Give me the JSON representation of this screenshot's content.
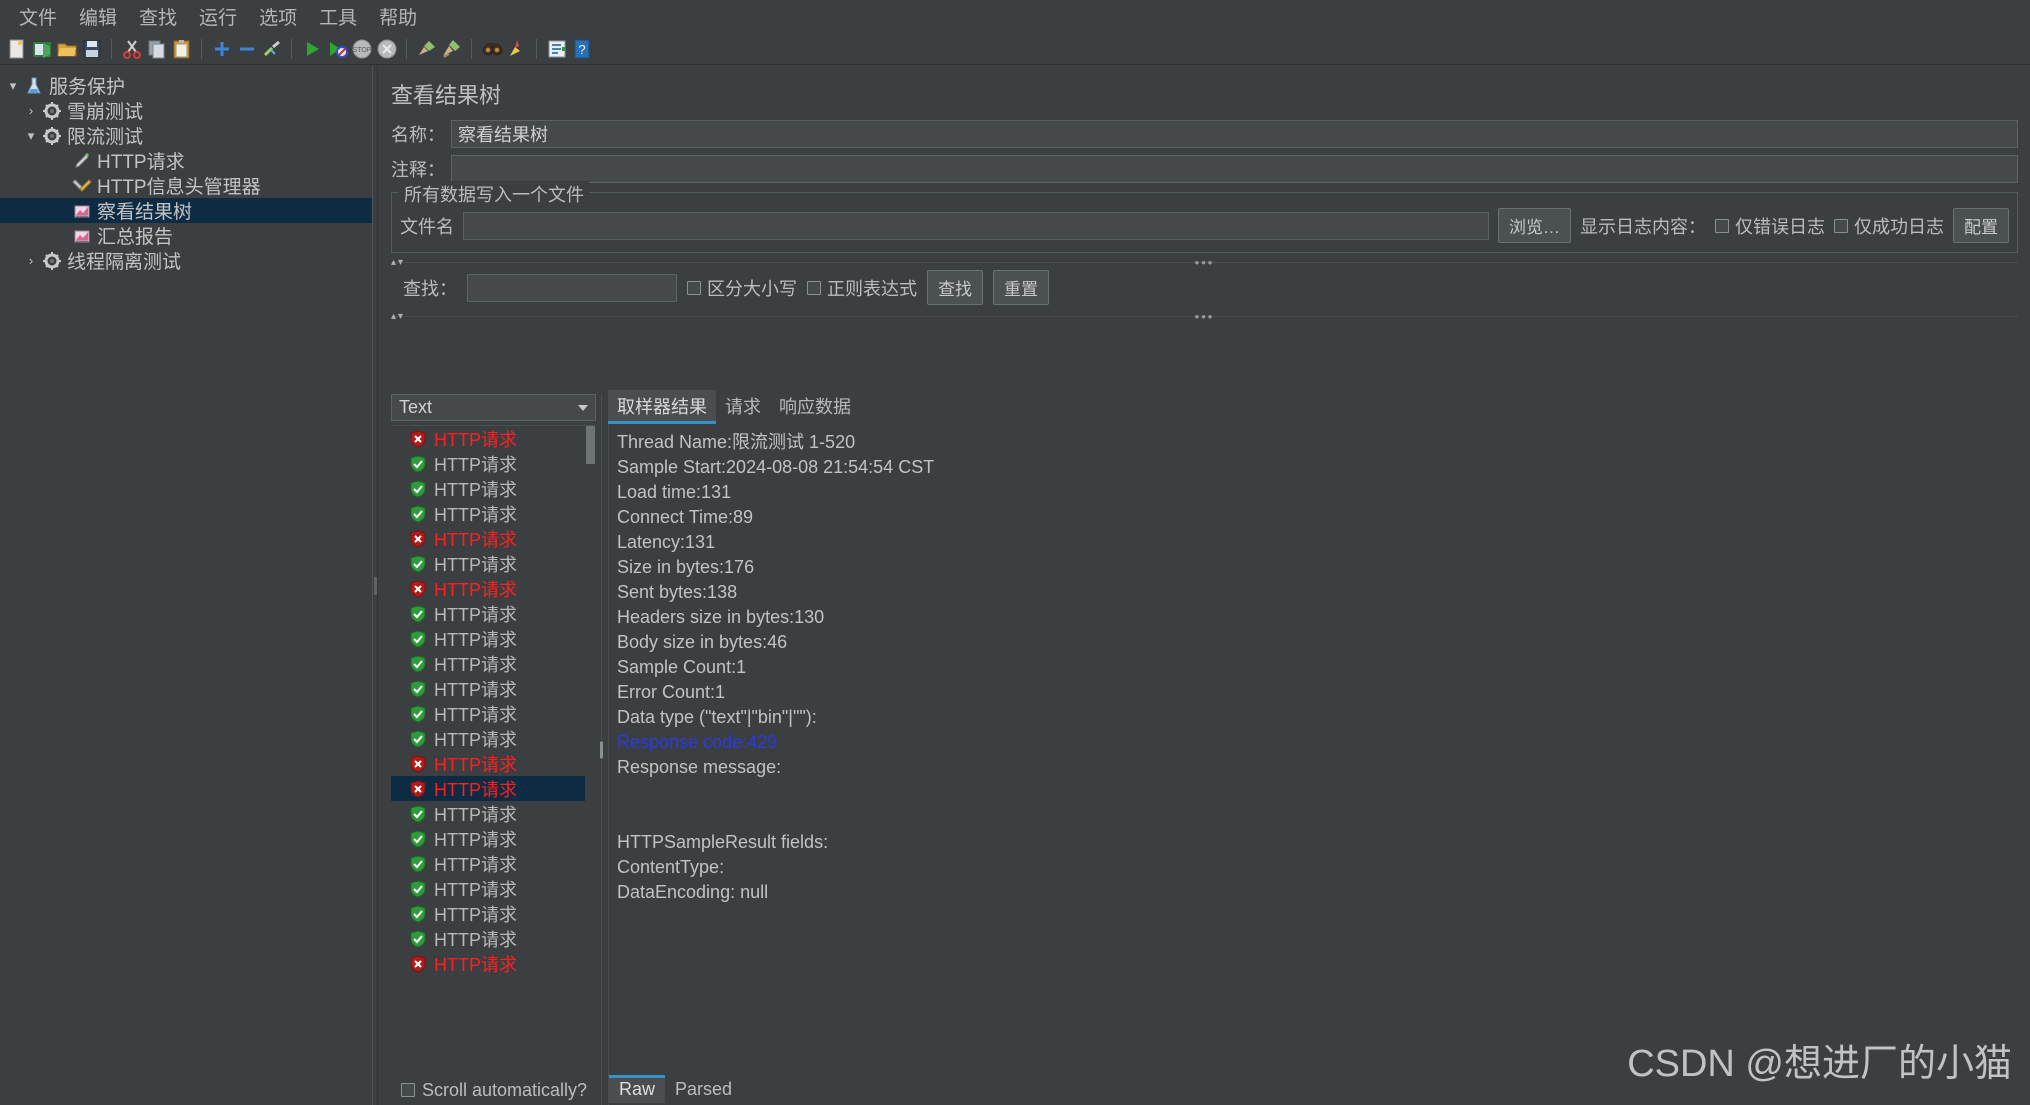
{
  "menubar": {
    "items": [
      "文件",
      "编辑",
      "查找",
      "运行",
      "选项",
      "工具",
      "帮助"
    ]
  },
  "toolbar": {
    "buttons": [
      {
        "name": "new-icon",
        "title": "新建"
      },
      {
        "name": "templates-icon",
        "title": "模板"
      },
      {
        "name": "open-icon",
        "title": "打开"
      },
      {
        "name": "save-icon",
        "title": "保存"
      },
      {
        "name": "cut-icon",
        "title": "剪切"
      },
      {
        "name": "copy-icon",
        "title": "复制"
      },
      {
        "name": "paste-icon",
        "title": "粘贴"
      },
      {
        "name": "expand-all-icon",
        "title": "展开全部"
      },
      {
        "name": "collapse-all-icon",
        "title": "折叠全部"
      },
      {
        "name": "toggle-icon",
        "title": "启用/禁用"
      },
      {
        "name": "start-icon",
        "title": "启动"
      },
      {
        "name": "start-no-timers-icon",
        "title": "无间隔启动"
      },
      {
        "name": "stop-icon",
        "title": "停止"
      },
      {
        "name": "shutdown-icon",
        "title": "关闭"
      },
      {
        "name": "clear-icon",
        "title": "清除"
      },
      {
        "name": "clear-all-icon",
        "title": "清除全部"
      },
      {
        "name": "search-icon",
        "title": "查找"
      },
      {
        "name": "search-reset-icon",
        "title": "重置查找"
      },
      {
        "name": "function-helper-icon",
        "title": "函数助手"
      },
      {
        "name": "help-icon",
        "title": "帮助"
      }
    ]
  },
  "tree": {
    "nodes": [
      {
        "label": "服务保护",
        "icon": "test-plan-icon",
        "twisty": "▾",
        "indent": 0,
        "selected": false
      },
      {
        "label": "雪崩测试",
        "icon": "thread-group-icon",
        "twisty": "›",
        "indent": 1,
        "selected": false
      },
      {
        "label": "限流测试",
        "icon": "thread-group-icon",
        "twisty": "▾",
        "indent": 1,
        "selected": false
      },
      {
        "label": "HTTP请求",
        "icon": "http-sampler-icon",
        "twisty": "",
        "indent": 2,
        "selected": false
      },
      {
        "label": "HTTP信息头管理器",
        "icon": "header-manager-icon",
        "twisty": "",
        "indent": 2,
        "selected": false
      },
      {
        "label": "察看结果树",
        "icon": "listener-icon",
        "twisty": "",
        "indent": 2,
        "selected": true
      },
      {
        "label": "汇总报告",
        "icon": "listener-icon",
        "twisty": "",
        "indent": 2,
        "selected": false
      },
      {
        "label": "线程隔离测试",
        "icon": "thread-group-icon",
        "twisty": "›",
        "indent": 1,
        "selected": false
      }
    ]
  },
  "panel": {
    "title": "查看结果树",
    "name_label": "名称：",
    "name_value": "察看结果树",
    "comment_label": "注释：",
    "comment_value": "",
    "file_group_title": "所有数据写入一个文件",
    "filename_label": "文件名",
    "filename_value": "",
    "browse_button": "浏览…",
    "log_display_label": "显示日志内容：",
    "error_only_label": "仅错误日志",
    "success_only_label": "仅成功日志",
    "configure_button": "配置"
  },
  "search": {
    "label": "查找：",
    "value": "",
    "case_sensitive_label": "区分大小写",
    "regex_label": "正则表达式",
    "find_button": "查找",
    "reset_button": "重置"
  },
  "results": {
    "renderer_selected": "Text",
    "scroll_auto_label": "Scroll automatically?",
    "item_label": "HTTP请求",
    "items": [
      {
        "status": "err",
        "selected": false
      },
      {
        "status": "ok",
        "selected": false
      },
      {
        "status": "ok",
        "selected": false
      },
      {
        "status": "ok",
        "selected": false
      },
      {
        "status": "err",
        "selected": false
      },
      {
        "status": "ok",
        "selected": false
      },
      {
        "status": "err",
        "selected": false
      },
      {
        "status": "ok",
        "selected": false
      },
      {
        "status": "ok",
        "selected": false
      },
      {
        "status": "ok",
        "selected": false
      },
      {
        "status": "ok",
        "selected": false
      },
      {
        "status": "ok",
        "selected": false
      },
      {
        "status": "ok",
        "selected": false
      },
      {
        "status": "err",
        "selected": false
      },
      {
        "status": "err",
        "selected": true
      },
      {
        "status": "ok",
        "selected": false
      },
      {
        "status": "ok",
        "selected": false
      },
      {
        "status": "ok",
        "selected": false
      },
      {
        "status": "ok",
        "selected": false
      },
      {
        "status": "ok",
        "selected": false
      },
      {
        "status": "ok",
        "selected": false
      },
      {
        "status": "err",
        "selected": false
      }
    ]
  },
  "detail": {
    "tabs": [
      {
        "label": "取样器结果",
        "active": true
      },
      {
        "label": "请求",
        "active": false
      },
      {
        "label": "响应数据",
        "active": false
      }
    ],
    "lines": [
      {
        "text": "Thread Name:限流测试 1-520",
        "kind": "normal"
      },
      {
        "text": "Sample Start:2024-08-08 21:54:54 CST",
        "kind": "normal"
      },
      {
        "text": "Load time:131",
        "kind": "normal"
      },
      {
        "text": "Connect Time:89",
        "kind": "normal"
      },
      {
        "text": "Latency:131",
        "kind": "normal"
      },
      {
        "text": "Size in bytes:176",
        "kind": "normal"
      },
      {
        "text": "Sent bytes:138",
        "kind": "normal"
      },
      {
        "text": "Headers size in bytes:130",
        "kind": "normal"
      },
      {
        "text": "Body size in bytes:46",
        "kind": "normal"
      },
      {
        "text": "Sample Count:1",
        "kind": "normal"
      },
      {
        "text": "Error Count:1",
        "kind": "normal"
      },
      {
        "text": "Data type (\"text\"|\"bin\"|\"\"):",
        "kind": "normal"
      },
      {
        "text": "Response code:429",
        "kind": "code"
      },
      {
        "text": "Response message:",
        "kind": "normal"
      },
      {
        "text": "",
        "kind": "blank"
      },
      {
        "text": "",
        "kind": "blank"
      },
      {
        "text": "HTTPSampleResult fields:",
        "kind": "normal"
      },
      {
        "text": "ContentType:",
        "kind": "normal"
      },
      {
        "text": "DataEncoding: null",
        "kind": "normal"
      }
    ],
    "bottom_tabs": [
      {
        "label": "Raw",
        "active": true
      },
      {
        "label": "Parsed",
        "active": false
      }
    ]
  },
  "watermark": "CSDN @想进厂的小猫",
  "colors": {
    "background": "#3c3f41",
    "selection": "#0d2b42",
    "accent": "#3592c4",
    "error_text": "#ff1f1f",
    "response_code": "#2a3ae0"
  }
}
